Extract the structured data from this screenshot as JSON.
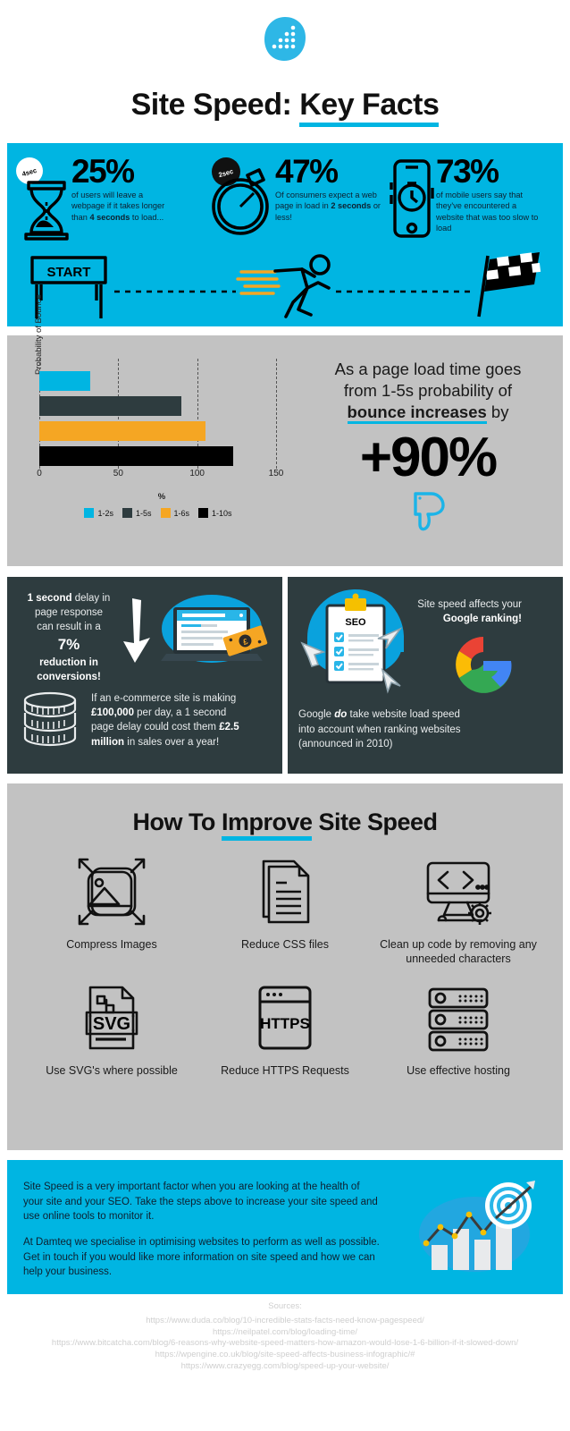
{
  "header": {
    "logo_icon": "damteq-dots-logo",
    "title_main": "Site Speed: ",
    "title_underlined": "Key Facts"
  },
  "stats": {
    "items": [
      {
        "icon": "hourglass-icon",
        "badge": "4sec",
        "percent": "25%",
        "text_1": "of users will leave a",
        "text_2": "webpage if it takes longer",
        "text_3a": "than ",
        "text_3b": "4 seconds",
        "text_3c": " to load..."
      },
      {
        "icon": "stopwatch-icon",
        "badge": "2sec",
        "percent": "47%",
        "text_1": "Of consumers expect a web",
        "text_2a": "page in load in ",
        "text_2b": "2 seconds",
        "text_2c": " or",
        "text_3": "less!"
      },
      {
        "icon": "mobile-clock-icon",
        "badge": "",
        "percent": "73%",
        "text_1": "of mobile users say that",
        "text_2": "they've encountered a",
        "text_3": "website that was too slow to",
        "text_4": "load"
      }
    ],
    "race": {
      "start_label": "START",
      "runner_icon": "running-man-icon",
      "finish_icon": "checkered-flag-icon"
    }
  },
  "chart_data": {
    "type": "bar",
    "orientation": "horizontal",
    "title": "",
    "categories": [
      "1-2s",
      "1-5s",
      "1-6s",
      "1-10s"
    ],
    "values": [
      32,
      90,
      105,
      123
    ],
    "colors": [
      "#00b5e2",
      "#2e3c3f",
      "#f5a623",
      "#000000"
    ],
    "xlabel": "%",
    "ylabel": "Probability of Bounce",
    "xlim": [
      0,
      150
    ],
    "xticks": [
      0,
      50,
      100,
      150
    ],
    "xtick_labels": [
      "0",
      "50",
      "100",
      "150"
    ],
    "grid": true,
    "legend": [
      "1-2s",
      "1-5s",
      "1-6s",
      "1-10s"
    ],
    "legend_position": "bottom"
  },
  "chart_callout": {
    "line_1": "As a page load time goes",
    "line_2": "from 1-5s probability of",
    "line_3_bold": "bounce increases",
    "line_3_rest": " by",
    "big_value": "+90%",
    "icon": "thumbs-down-icon"
  },
  "panel_left": {
    "head_1_bold": "1 second",
    "head_1_rest": " delay in",
    "head_2": "page response",
    "head_3": "can result in a",
    "head_4": "7%",
    "head_5": "reduction in",
    "head_6": "conversions!",
    "arrow_icon": "down-arrow-icon",
    "laptop_icon": "laptop-money-icon",
    "coins_icon": "coin-stack-icon",
    "body_1": "If an e-commerce site is making",
    "body_2a": "£100,000",
    "body_2b": " per day, a 1 second",
    "body_3a": "page delay could cost them ",
    "body_3b": "£2.5",
    "body_4a": "million",
    "body_4b": " in sales over a year!"
  },
  "panel_right": {
    "head_1": "Site speed affects your",
    "head_2_bold": "Google ranking!",
    "clipboard_icon": "seo-clipboard-icon",
    "clipboard_label": "SEO",
    "google_icon": "google-g-icon",
    "cursor_icon": "mouse-cursor-icon",
    "body_1a": "Google ",
    "body_1b": "do",
    "body_1c": " take website load speed",
    "body_2": "into account when ranking websites",
    "body_3": "(announced in 2010)"
  },
  "improve": {
    "title_a": "How To ",
    "title_underlined": "Improve",
    "title_b": " Site Speed",
    "tips": [
      {
        "icon": "compress-image-icon",
        "label": "Compress Images"
      },
      {
        "icon": "css-files-icon",
        "label": "Reduce CSS files"
      },
      {
        "icon": "code-cleanup-icon",
        "label": "Clean up code by removing any unneeded characters"
      },
      {
        "icon": "svg-file-icon",
        "label": "Use SVG's where possible",
        "glyph": "SVG"
      },
      {
        "icon": "https-browser-icon",
        "label": "Reduce HTTPS Requests",
        "glyph": "HTTPS"
      },
      {
        "icon": "server-rack-icon",
        "label": "Use effective hosting"
      }
    ]
  },
  "bottom": {
    "para_1": "Site Speed is a very important factor when you are looking at the health of your site and your SEO. Take the steps above to increase your site speed and use online tools to monitor it.",
    "para_2": "At Damteq we specialise in optimising websites to perform as well as possible. Get in touch if you would like more information on site speed and how we can help your business.",
    "icon": "growth-chart-target-icon"
  },
  "sources": {
    "heading": "Sources:",
    "links": [
      "https://www.duda.co/blog/10-incredible-stats-facts-need-know-pagespeed/",
      "https://neilpatel.com/blog/loading-time/",
      "https://www.bitcatcha.com/blog/6-reasons-why-website-speed-matters-how-amazon-would-lose-1-6-billion-if-it-slowed-down/",
      "https://wpengine.co.uk/blog/site-speed-affects-business-infographic/#",
      "https://www.crazyegg.com/blog/speed-up-your-website/"
    ]
  },
  "palette": {
    "brand_blue": "#00b5e2",
    "dark_slate": "#2e3c3f",
    "grey_panel": "#c2c2c2",
    "orange": "#f5a623",
    "black": "#000000"
  }
}
